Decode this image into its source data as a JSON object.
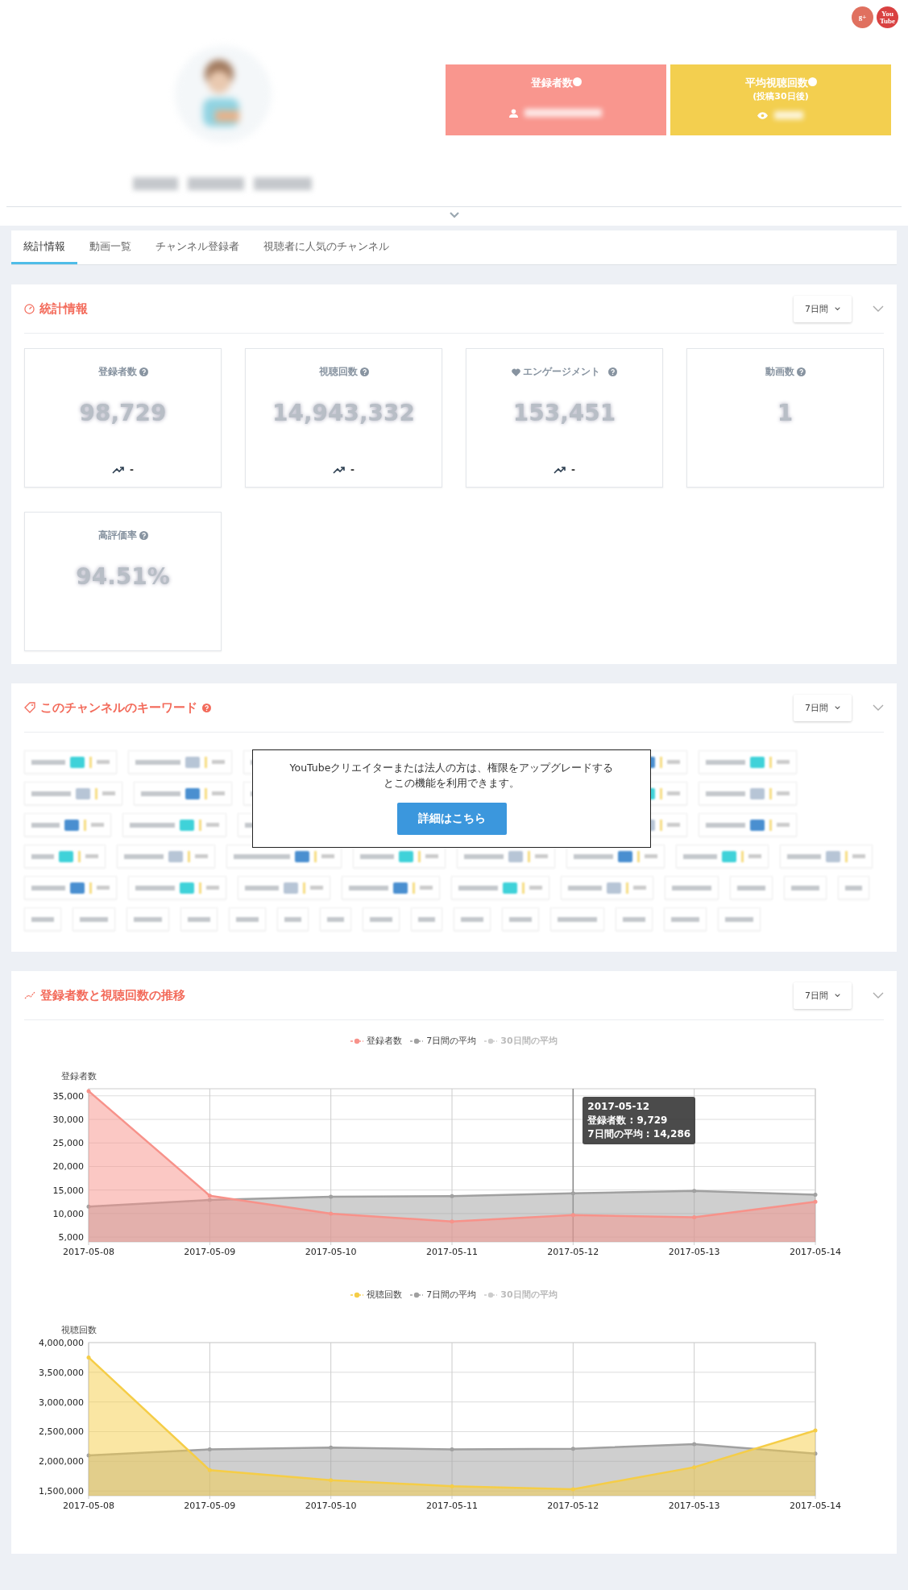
{
  "social": [
    {
      "kind": "gplus",
      "label": "g+"
    },
    {
      "kind": "youtube",
      "label": "You Tube"
    }
  ],
  "header_stats": [
    {
      "kind": "subscribers",
      "label": "登録者数"
    },
    {
      "kind": "avg_views",
      "label": "平均視聴回数",
      "sublabel": "(投稿30日後)"
    }
  ],
  "tabs": [
    {
      "label": "統計情報",
      "selected": true
    },
    {
      "label": "動画一覧",
      "selected": false
    },
    {
      "label": "チャンネル登録者",
      "selected": false
    },
    {
      "label": "視聴者に人気のチャンネル",
      "selected": false
    }
  ],
  "stats_section": {
    "title": "統計情報",
    "period": "7日間",
    "cards": [
      {
        "label": "登録者数",
        "heart": false,
        "value": "98,729",
        "trend": "-"
      },
      {
        "label": "視聴回数",
        "heart": false,
        "value": "14,943,332",
        "trend": "-"
      },
      {
        "label": "エンゲージメント",
        "heart": true,
        "value": "153,451",
        "trend": "-"
      },
      {
        "label": "動画数",
        "heart": false,
        "value": "1"
      },
      {
        "label": "高評価率",
        "heart": false,
        "value": "94.51%"
      }
    ]
  },
  "keyword_section": {
    "title": "このチャンネルのキーワード",
    "period": "7日間",
    "notice": "YouTubeクリエイターまたは法人の方は、権限をアップグレードするとこの機能を利用できます。",
    "button": "詳細はこちら"
  },
  "trend_section": {
    "title": "登録者数と視聴回数の推移",
    "period": "7日間",
    "charts": [
      {
        "chart_data": {
          "type": "area",
          "ylabel": "登録者数",
          "categories": [
            "2017-05-08",
            "2017-05-09",
            "2017-05-10",
            "2017-05-11",
            "2017-05-12",
            "2017-05-13",
            "2017-05-14"
          ],
          "ylim": [
            4000,
            36500
          ],
          "yticks": [
            {
              "value": 5000,
              "label": "5,000"
            },
            {
              "value": 10000,
              "label": "10,000"
            },
            {
              "value": 15000,
              "label": "15,000"
            },
            {
              "value": 20000,
              "label": "20,000"
            },
            {
              "value": 25000,
              "label": "25,000"
            },
            {
              "value": 30000,
              "label": "30,000"
            },
            {
              "value": 35000,
              "label": "35,000"
            }
          ],
          "series": [
            {
              "name": "登録者数",
              "color": "#f7928a",
              "values": [
                36000,
                13800,
                10000,
                8300,
                9700,
                9200,
                12500
              ]
            },
            {
              "name": "7日間の平均",
              "color": "#a0a0a0",
              "values": [
                11500,
                12900,
                13600,
                13700,
                14300,
                14800,
                14000
              ]
            }
          ],
          "grid": true,
          "ref_lines": [
            {
              "axis": "x",
              "value": "2017-05-12",
              "color": "#888888"
            }
          ]
        },
        "inactive_legend": {
          "name": "30日間の平均",
          "color": "#cccccc"
        },
        "tooltip": {
          "title": "2017-05-12",
          "lines": [
            "登録者数 : 9,729",
            "7日間の平均 : 14,286"
          ]
        }
      },
      {
        "chart_data": {
          "type": "area",
          "ylabel": "視聴回数",
          "categories": [
            "2017-05-08",
            "2017-05-09",
            "2017-05-10",
            "2017-05-11",
            "2017-05-12",
            "2017-05-13",
            "2017-05-14"
          ],
          "ylim": [
            1420000,
            4000000
          ],
          "yticks": [
            {
              "value": 1500000,
              "label": "1,500,000"
            },
            {
              "value": 2000000,
              "label": "2,000,000"
            },
            {
              "value": 2500000,
              "label": "2,500,000"
            },
            {
              "value": 3000000,
              "label": "3,000,000"
            },
            {
              "value": 3500000,
              "label": "3,500,000"
            },
            {
              "value": 4000000,
              "label": "4,000,000"
            }
          ],
          "series": [
            {
              "name": "視聴回数",
              "color": "#f5cd47",
              "values": [
                3750000,
                1850000,
                1680000,
                1580000,
                1530000,
                1900000,
                2520000
              ]
            },
            {
              "name": "7日間の平均",
              "color": "#a0a0a0",
              "values": [
                2100000,
                2200000,
                2230000,
                2200000,
                2210000,
                2290000,
                2130000
              ]
            }
          ],
          "grid": true
        },
        "inactive_legend": {
          "name": "30日間の平均",
          "color": "#cccccc"
        }
      }
    ]
  }
}
